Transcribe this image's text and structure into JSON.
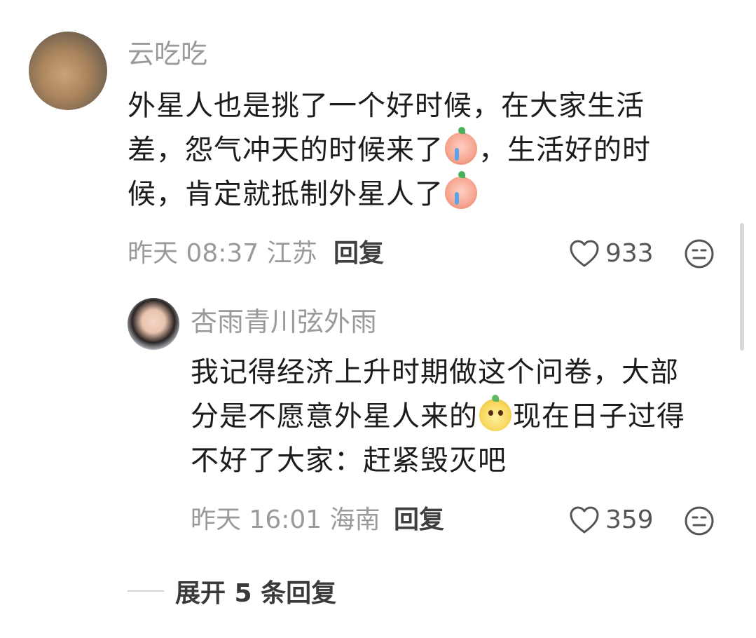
{
  "main_comment": {
    "username": "云吃吃",
    "lines": [
      [
        "外星人也是挑了一个好时候，在大家生活"
      ],
      [
        "差，怨气冲天的时候来了",
        "cry-emoji",
        "，生活好的时"
      ],
      [
        "候，肯定就抵制外星人了",
        "cry-emoji"
      ]
    ],
    "line1": "外星人也是挑了一个好时候，在大家生活",
    "line2_a": "差，怨气冲天的时候来了",
    "line2_b": "，生活好的时",
    "line3_a": "候，肯定就抵制外星人了",
    "time_location": "昨天 08:37 江苏",
    "reply_label": "回复",
    "likes": "933"
  },
  "sub_comment": {
    "username": "杏雨青川弦外雨",
    "line1": "我记得经济上升时期做这个问卷，大部",
    "line2_a": "分是不愿意外星人来的",
    "line2_b": "现在日子过得",
    "line3": "不好了大家：赶紧毁灭吧",
    "time_location": "昨天 16:01 海南",
    "reply_label": "回复",
    "likes": "359"
  },
  "expand_replies": "展开 5 条回复",
  "icons": {
    "like": "heart-outline-icon",
    "dislike": "unhappy-face-icon",
    "emoji_main": "crying-face-emoji",
    "emoji_sub": "puppy-face-emoji"
  },
  "colors": {
    "text_primary": "#1c1c1c",
    "text_secondary": "#9a9a9a",
    "icon": "#555555"
  }
}
